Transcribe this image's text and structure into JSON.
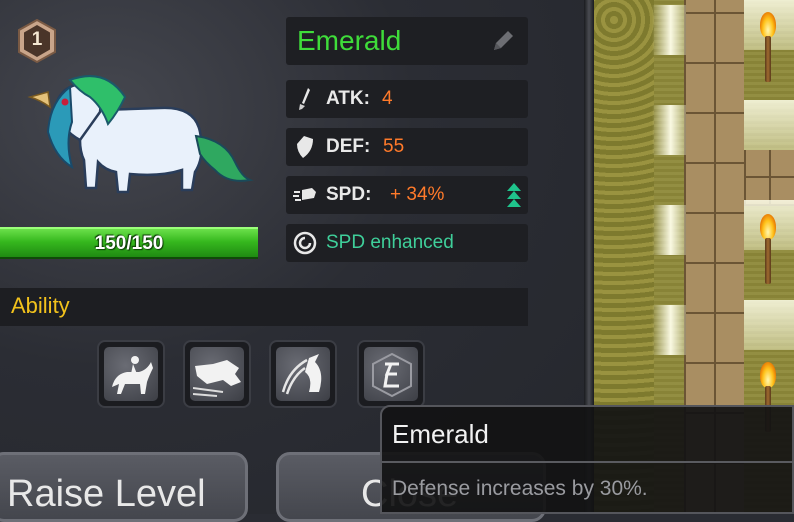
{
  "pet": {
    "level": "1",
    "name": "Emerald",
    "hp": "150/150",
    "hp_fraction": 1.0
  },
  "stats": {
    "atk_label": "ATK:",
    "atk_value": "4",
    "def_label": "DEF:",
    "def_value": "55",
    "spd_label": "SPD:",
    "spd_value": "+ 34%",
    "effect": "SPD enhanced"
  },
  "ability": {
    "title": "Ability",
    "skills": [
      {
        "icon": "horse-rider-skill-icon"
      },
      {
        "icon": "wolf-charge-skill-icon"
      },
      {
        "icon": "unicorn-slash-skill-icon"
      },
      {
        "icon": "emerald-shield-skill-icon"
      }
    ]
  },
  "buttons": {
    "raise_level": "Raise Level",
    "close": "Close"
  },
  "tooltip": {
    "title": "Emerald",
    "description": "Defense increases by 30%."
  },
  "colors": {
    "name": "#3fdc3a",
    "stat_value": "#ff7a2a",
    "effect": "#3fcf9a",
    "ability_title": "#f2c21c",
    "hp_bar": "#36b81e"
  }
}
